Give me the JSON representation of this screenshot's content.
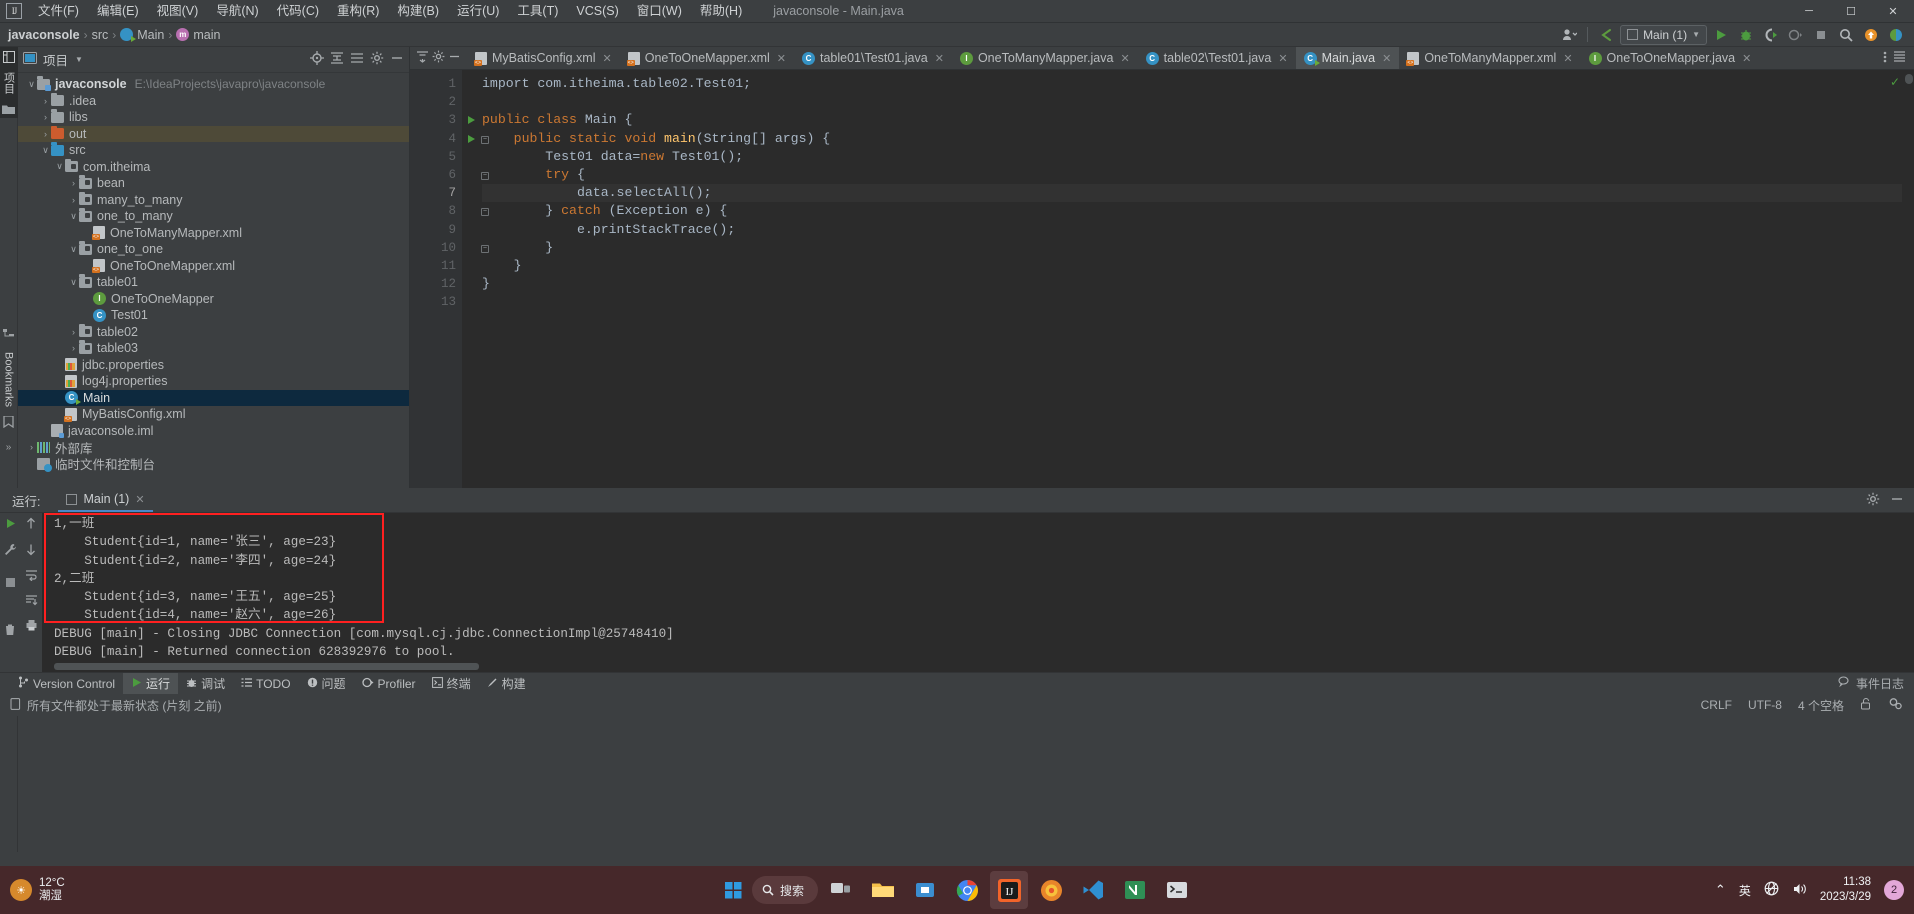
{
  "window": {
    "title": "javaconsole - Main.java",
    "logo": "intellij-idea-logo",
    "minimize": "─",
    "maximize": "☐",
    "close": "✕"
  },
  "menubar": {
    "items": [
      {
        "label": "文件(F)"
      },
      {
        "label": "编辑(E)"
      },
      {
        "label": "视图(V)"
      },
      {
        "label": "导航(N)"
      },
      {
        "label": "代码(C)"
      },
      {
        "label": "重构(R)"
      },
      {
        "label": "构建(B)"
      },
      {
        "label": "运行(U)"
      },
      {
        "label": "工具(T)"
      },
      {
        "label": "VCS(S)"
      },
      {
        "label": "窗口(W)"
      },
      {
        "label": "帮助(H)"
      }
    ]
  },
  "navbar": {
    "breadcrumbs": [
      {
        "label": "javaconsole",
        "icon": "none"
      },
      {
        "label": "src",
        "icon": "none"
      },
      {
        "label": "Main",
        "icon": "class-icon"
      },
      {
        "label": "main",
        "icon": "method-icon"
      }
    ],
    "separator": "›",
    "run_config": "Main (1)",
    "toolbar_icons": [
      "user-avatar-icon",
      "back-arrow-icon",
      "run-icon",
      "debug-icon",
      "run-with-coverage-icon",
      "profiler-icon",
      "stop-icon",
      "search-icon",
      "updates-icon",
      "ide-icon"
    ]
  },
  "project": {
    "panel_title": "项目",
    "header_icons": [
      "locate-icon",
      "expand-icon",
      "collapse-icon",
      "settings-icon",
      "hide-icon"
    ],
    "tree": [
      {
        "label": "javaconsole",
        "path": "E:\\IdeaProjects\\javapro\\javaconsole",
        "indent": 0,
        "arrow": "∨",
        "icon": "module-icon",
        "bold": true,
        "state": "none"
      },
      {
        "label": ".idea",
        "indent": 1,
        "arrow": "›",
        "icon": "folder-grey",
        "state": "none"
      },
      {
        "label": "libs",
        "indent": 1,
        "arrow": "›",
        "icon": "folder-grey",
        "state": "none"
      },
      {
        "label": "out",
        "indent": 1,
        "arrow": "›",
        "icon": "folder-orange",
        "state": "highlight"
      },
      {
        "label": "src",
        "indent": 1,
        "arrow": "∨",
        "icon": "folder-blue",
        "state": "none"
      },
      {
        "label": "com.itheima",
        "indent": 2,
        "arrow": "∨",
        "icon": "package-icon",
        "state": "none"
      },
      {
        "label": "bean",
        "indent": 3,
        "arrow": "›",
        "icon": "package-icon",
        "state": "none"
      },
      {
        "label": "many_to_many",
        "indent": 3,
        "arrow": "›",
        "icon": "package-icon",
        "state": "none"
      },
      {
        "label": "one_to_many",
        "indent": 3,
        "arrow": "∨",
        "icon": "package-icon",
        "state": "none"
      },
      {
        "label": "OneToManyMapper.xml",
        "indent": 4,
        "arrow": "",
        "icon": "xml-icon",
        "state": "none"
      },
      {
        "label": "one_to_one",
        "indent": 3,
        "arrow": "∨",
        "icon": "package-icon",
        "state": "none"
      },
      {
        "label": "OneToOneMapper.xml",
        "indent": 4,
        "arrow": "",
        "icon": "xml-icon",
        "state": "none"
      },
      {
        "label": "table01",
        "indent": 3,
        "arrow": "∨",
        "icon": "package-icon",
        "state": "none"
      },
      {
        "label": "OneToOneMapper",
        "indent": 4,
        "arrow": "",
        "icon": "interface-icon",
        "state": "none"
      },
      {
        "label": "Test01",
        "indent": 4,
        "arrow": "",
        "icon": "class-icon",
        "state": "none"
      },
      {
        "label": "table02",
        "indent": 3,
        "arrow": "›",
        "icon": "package-icon",
        "state": "none"
      },
      {
        "label": "table03",
        "indent": 3,
        "arrow": "›",
        "icon": "package-icon",
        "state": "none"
      },
      {
        "label": "jdbc.properties",
        "indent": 2,
        "arrow": "",
        "icon": "properties-icon",
        "state": "none"
      },
      {
        "label": "log4j.properties",
        "indent": 2,
        "arrow": "",
        "icon": "properties-icon",
        "state": "none"
      },
      {
        "label": "Main",
        "indent": 2,
        "arrow": "",
        "icon": "main-class-icon",
        "state": "selected"
      },
      {
        "label": "MyBatisConfig.xml",
        "indent": 2,
        "arrow": "",
        "icon": "xml-icon",
        "state": "none"
      },
      {
        "label": "javaconsole.iml",
        "indent": 1,
        "arrow": "",
        "icon": "iml-icon",
        "state": "none"
      },
      {
        "label": "外部库",
        "indent": 0,
        "arrow": "›",
        "icon": "library-icon",
        "state": "none"
      },
      {
        "label": "临时文件和控制台",
        "indent": 0,
        "arrow": "",
        "icon": "scratches-icon",
        "state": "none"
      }
    ]
  },
  "left_strip": {
    "project_label": "项目",
    "bookmarks_label": "Bookmarks",
    "structure_label": "结构"
  },
  "editor": {
    "lead_icons": [
      "collapse-all-icon",
      "settings-icon",
      "hide-icon"
    ],
    "tabs": [
      {
        "label": "MyBatisConfig.xml",
        "icon": "xml-icon",
        "active": false
      },
      {
        "label": "OneToOneMapper.xml",
        "icon": "xml-icon",
        "active": false
      },
      {
        "label": "table01\\Test01.java",
        "icon": "class-icon",
        "active": false
      },
      {
        "label": "OneToManyMapper.java",
        "icon": "interface-icon",
        "active": false
      },
      {
        "label": "table02\\Test01.java",
        "icon": "class-icon",
        "active": false
      },
      {
        "label": "Main.java",
        "icon": "main-class-icon",
        "active": true
      },
      {
        "label": "OneToManyMapper.xml",
        "icon": "xml-icon",
        "active": false
      },
      {
        "label": "OneToOneMapper.java",
        "icon": "interface-icon",
        "active": false
      }
    ],
    "tab_close": "✕",
    "tail_icons": [
      "more-tabs-icon",
      "tab-list-icon"
    ],
    "inspection_status": "✓",
    "lines": [
      {
        "n": "1",
        "runmark": false,
        "fold": "",
        "current": false,
        "tokens": [
          {
            "t": "import com.itheima.table02.Test01;",
            "c": "cls"
          }
        ],
        "indent": 0
      },
      {
        "n": "2",
        "runmark": false,
        "fold": "",
        "current": false,
        "tokens": [],
        "indent": 0
      },
      {
        "n": "3",
        "runmark": true,
        "fold": "",
        "current": false,
        "tokens": [
          {
            "t": "public class ",
            "c": "kw"
          },
          {
            "t": "Main {",
            "c": "cls"
          }
        ],
        "indent": 0
      },
      {
        "n": "4",
        "runmark": true,
        "fold": "−",
        "current": false,
        "tokens": [
          {
            "t": "    public static void ",
            "c": "kw"
          },
          {
            "t": "main",
            "c": "fn"
          },
          {
            "t": "(String[] args) {",
            "c": "cls"
          }
        ],
        "indent": 0
      },
      {
        "n": "5",
        "runmark": false,
        "fold": "",
        "current": false,
        "tokens": [
          {
            "t": "        Test01 data=",
            "c": "cls"
          },
          {
            "t": "new ",
            "c": "kw"
          },
          {
            "t": "Test01();",
            "c": "cls"
          }
        ],
        "indent": 0
      },
      {
        "n": "6",
        "runmark": false,
        "fold": "−",
        "current": false,
        "tokens": [
          {
            "t": "        try ",
            "c": "kw"
          },
          {
            "t": "{",
            "c": "cls"
          }
        ],
        "indent": 0
      },
      {
        "n": "7",
        "runmark": false,
        "fold": "",
        "current": true,
        "tokens": [
          {
            "t": "            data.selectAll();",
            "c": "cls"
          }
        ],
        "indent": 0
      },
      {
        "n": "8",
        "runmark": false,
        "fold": "−",
        "current": false,
        "tokens": [
          {
            "t": "        } ",
            "c": "cls"
          },
          {
            "t": "catch ",
            "c": "kw"
          },
          {
            "t": "(Exception e) {",
            "c": "cls"
          }
        ],
        "indent": 0
      },
      {
        "n": "9",
        "runmark": false,
        "fold": "",
        "current": false,
        "tokens": [
          {
            "t": "            e.printStackTrace();",
            "c": "cls"
          }
        ],
        "indent": 0
      },
      {
        "n": "10",
        "runmark": false,
        "fold": "−",
        "current": false,
        "tokens": [
          {
            "t": "        }",
            "c": "cls"
          }
        ],
        "indent": 0
      },
      {
        "n": "11",
        "runmark": false,
        "fold": "",
        "current": false,
        "tokens": [
          {
            "t": "    }",
            "c": "cls"
          }
        ],
        "indent": 0
      },
      {
        "n": "12",
        "runmark": false,
        "fold": "",
        "current": false,
        "tokens": [
          {
            "t": "}",
            "c": "cls"
          }
        ],
        "indent": 0
      },
      {
        "n": "13",
        "runmark": false,
        "fold": "",
        "current": false,
        "tokens": [],
        "indent": 0
      }
    ]
  },
  "run_panel": {
    "label": "运行:",
    "tab": "Main (1)",
    "tab_close": "✕",
    "header_icons": [
      "settings-icon",
      "hide-icon"
    ],
    "gutter_icons": [
      "rerun-icon",
      "wrench-icon",
      "stop-icon",
      "trash-icon"
    ],
    "gutter2_icons": [
      "scroll-up-icon",
      "scroll-down-icon",
      "soft-wrap-icon",
      "scroll-to-end-icon",
      "print-icon"
    ],
    "console_lines": [
      {
        "text": "1,一班",
        "in_box": true
      },
      {
        "text": "    Student{id=1, name='张三', age=23}",
        "in_box": true
      },
      {
        "text": "    Student{id=2, name='李四', age=24}",
        "in_box": true
      },
      {
        "text": "2,二班",
        "in_box": true
      },
      {
        "text": "    Student{id=3, name='王五', age=25}",
        "in_box": true
      },
      {
        "text": "    Student{id=4, name='赵六', age=26}",
        "in_box": true
      },
      {
        "text": "DEBUG [main] - Closing JDBC Connection [com.mysql.cj.jdbc.ConnectionImpl@25748410]",
        "in_box": false
      },
      {
        "text": "DEBUG [main] - Returned connection 628392976 to pool.",
        "in_box": false
      }
    ],
    "highlight_color": "#ff2020"
  },
  "toolwindow_bar": {
    "items": [
      {
        "label": "Version Control",
        "icon": "branch-icon",
        "active": false
      },
      {
        "label": "运行",
        "icon": "run-icon",
        "active": true
      },
      {
        "label": "调试",
        "icon": "debug-icon",
        "active": false
      },
      {
        "label": "TODO",
        "icon": "todo-icon",
        "active": false
      },
      {
        "label": "问题",
        "icon": "problems-icon",
        "active": false
      },
      {
        "label": "Profiler",
        "icon": "profiler-icon",
        "active": false
      },
      {
        "label": "终端",
        "icon": "terminal-icon",
        "active": false
      },
      {
        "label": "构建",
        "icon": "build-icon",
        "active": false
      }
    ],
    "right": "事件日志",
    "right_icon": "event-log-icon"
  },
  "statusbar": {
    "message": "所有文件都处于最新状态 (片刻 之前)",
    "message_icon": "file-icon",
    "line_separator": "CRLF",
    "encoding": "UTF-8",
    "indent": "4 个空格",
    "lock_icon": "unlocked-icon",
    "inspection_icon": "inspection-widget-icon"
  },
  "taskbar": {
    "weather_temp": "12°C",
    "weather_desc": "潮湿",
    "search_placeholder": "搜索",
    "search_icon": "search-icon",
    "start_icon": "windows-start-icon",
    "apps": [
      {
        "name": "task-view-icon",
        "color": "#cfd3d6",
        "active": false
      },
      {
        "name": "file-explorer-icon",
        "color": "#f5c04a",
        "active": false
      },
      {
        "name": "store-icon",
        "color": "#3b8ed0",
        "active": false
      },
      {
        "name": "chrome-icon",
        "color": "#49a84c",
        "active": false
      },
      {
        "name": "intellij-idea-icon",
        "color": "#ec5f3d",
        "active": true
      },
      {
        "name": "firefox-icon",
        "color": "#e8852a",
        "active": false
      },
      {
        "name": "vscode-icon",
        "color": "#2f8fd1",
        "active": false
      },
      {
        "name": "navicat-icon",
        "color": "#2f8f55",
        "active": false
      },
      {
        "name": "terminal-icon",
        "color": "#d7dade",
        "active": false
      }
    ],
    "tray_chevron": "⌃",
    "tray_ime": "英",
    "tray_icons": [
      "network-icon",
      "volume-icon"
    ],
    "time": "11:38",
    "date": "2023/3/29",
    "notification_count": "2"
  },
  "colors": {
    "accent": "#4a88c7",
    "panel": "#3c3f41",
    "editor_bg": "#2b2b2b",
    "selection": "#0d293e",
    "keyword": "#cc7832",
    "method": "#ffc66d",
    "text": "#a9b7c6"
  }
}
